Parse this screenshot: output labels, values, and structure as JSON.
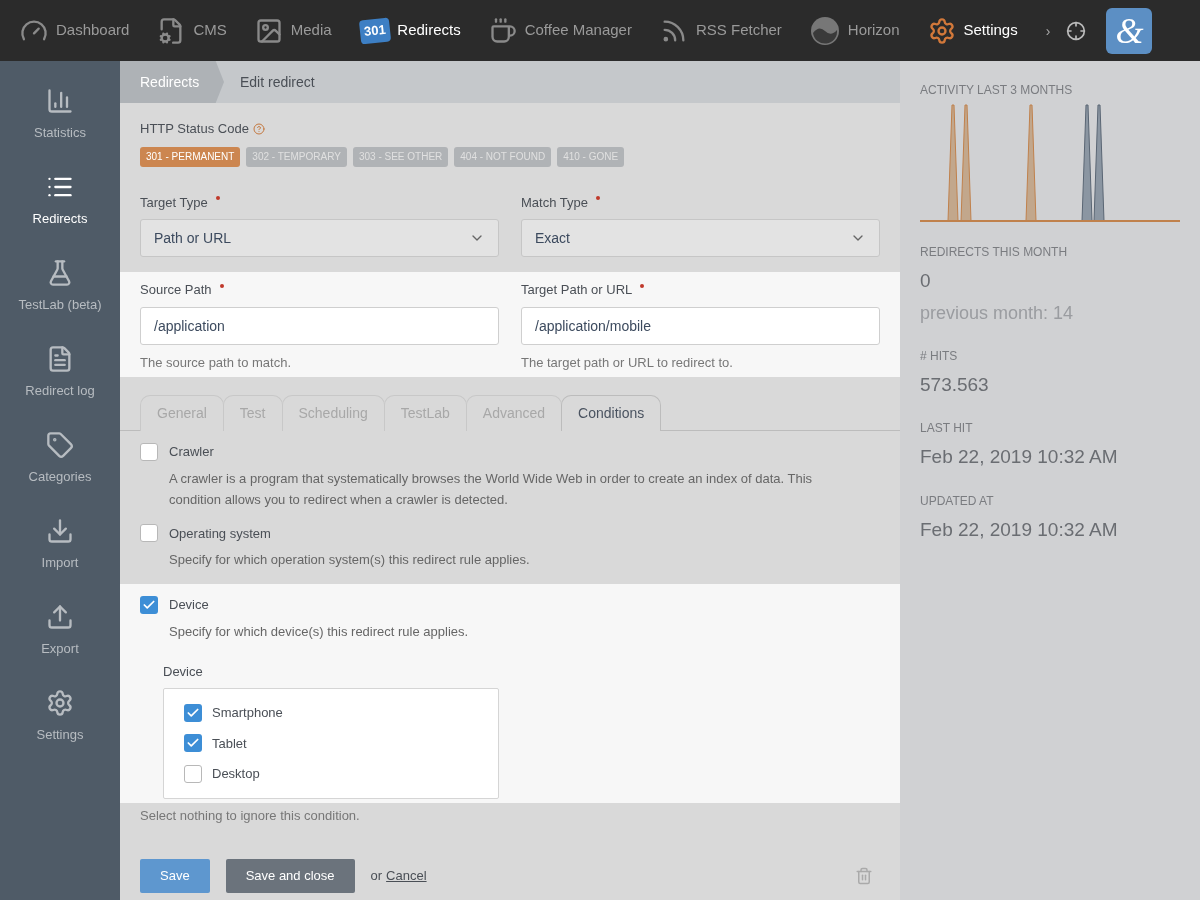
{
  "top_nav": {
    "items": [
      {
        "kind": "dashboard",
        "label": "Dashboard",
        "selected": false
      },
      {
        "kind": "cms",
        "label": "CMS",
        "selected": false
      },
      {
        "kind": "media",
        "label": "Media",
        "selected": false
      },
      {
        "kind": "redirects",
        "label": "Redirects",
        "icon_text": "301",
        "selected": true
      },
      {
        "kind": "coffee",
        "label": "Coffee Manager",
        "selected": false
      },
      {
        "kind": "rss",
        "label": "RSS Fetcher",
        "selected": false
      },
      {
        "kind": "horizon",
        "label": "Horizon",
        "selected": false
      },
      {
        "kind": "settings",
        "label": "Settings",
        "selected": true
      }
    ],
    "more": "›",
    "logo": "&"
  },
  "sidebar": {
    "items": [
      {
        "kind": "statistics",
        "label": "Statistics",
        "selected": false
      },
      {
        "kind": "redirects",
        "label": "Redirects",
        "selected": true
      },
      {
        "kind": "testlab",
        "label": "TestLab (beta)",
        "selected": false
      },
      {
        "kind": "log",
        "label": "Redirect log",
        "selected": false
      },
      {
        "kind": "categories",
        "label": "Categories",
        "selected": false
      },
      {
        "kind": "import",
        "label": "Import",
        "selected": false
      },
      {
        "kind": "export",
        "label": "Export",
        "selected": false
      },
      {
        "kind": "settings",
        "label": "Settings",
        "selected": false
      }
    ]
  },
  "breadcrumb": [
    "Redirects",
    "Edit redirect"
  ],
  "status_code": {
    "label": "HTTP Status Code",
    "options": [
      {
        "label": "301 - PERMANENT",
        "selected": true
      },
      {
        "label": "302 - TEMPORARY",
        "selected": false
      },
      {
        "label": "303 - SEE OTHER",
        "selected": false
      },
      {
        "label": "404 - NOT FOUND",
        "selected": false
      },
      {
        "label": "410 - GONE",
        "selected": false
      }
    ]
  },
  "selects": [
    {
      "label": "Target Type",
      "required": true,
      "value": "Path or URL"
    },
    {
      "label": "Match Type",
      "required": true,
      "value": "Exact"
    }
  ],
  "paths": [
    {
      "label": "Source Path",
      "required": true,
      "value": "/application",
      "help": "The source path to match."
    },
    {
      "label": "Target Path or URL",
      "required": true,
      "value": "/application/mobile",
      "help": "The target path or URL to redirect to."
    }
  ],
  "tabs": [
    {
      "label": "General",
      "selected": false
    },
    {
      "label": "Test",
      "selected": false
    },
    {
      "label": "Scheduling",
      "selected": false
    },
    {
      "label": "TestLab",
      "selected": false
    },
    {
      "label": "Advanced",
      "selected": false
    },
    {
      "label": "Conditions",
      "selected": true
    }
  ],
  "conditions": [
    {
      "label": "Crawler",
      "checked": false,
      "description": "A crawler is a program that systematically browses the World Wide Web in order to create an index of data. This condition allows you to redirect when a crawler is detected."
    },
    {
      "label": "Operating system",
      "checked": false,
      "description": "Specify for which operation system(s) this redirect rule applies."
    },
    {
      "label": "Device",
      "checked": true,
      "description": "Specify for which device(s) this redirect rule applies.",
      "options_label": "Device",
      "options": [
        {
          "label": "Smartphone",
          "checked": true
        },
        {
          "label": "Tablet",
          "checked": true
        },
        {
          "label": "Desktop",
          "checked": false
        }
      ],
      "hint": "Select nothing to ignore this condition."
    }
  ],
  "actions": {
    "save": "Save",
    "save_close": "Save and close",
    "or": "or",
    "cancel": "Cancel"
  },
  "stats": {
    "activity_title": "ACTIVITY LAST 3 MONTHS",
    "items": [
      {
        "label": "REDIRECTS THIS MONTH",
        "value": "0",
        "note": "previous month: 14"
      },
      {
        "label": "# HITS",
        "value": "573.563"
      },
      {
        "label": "LAST HIT",
        "value": "Feb 22, 2019 10:32 AM"
      },
      {
        "label": "UPDATED AT",
        "value": "Feb 22, 2019 10:32 AM"
      }
    ]
  }
}
